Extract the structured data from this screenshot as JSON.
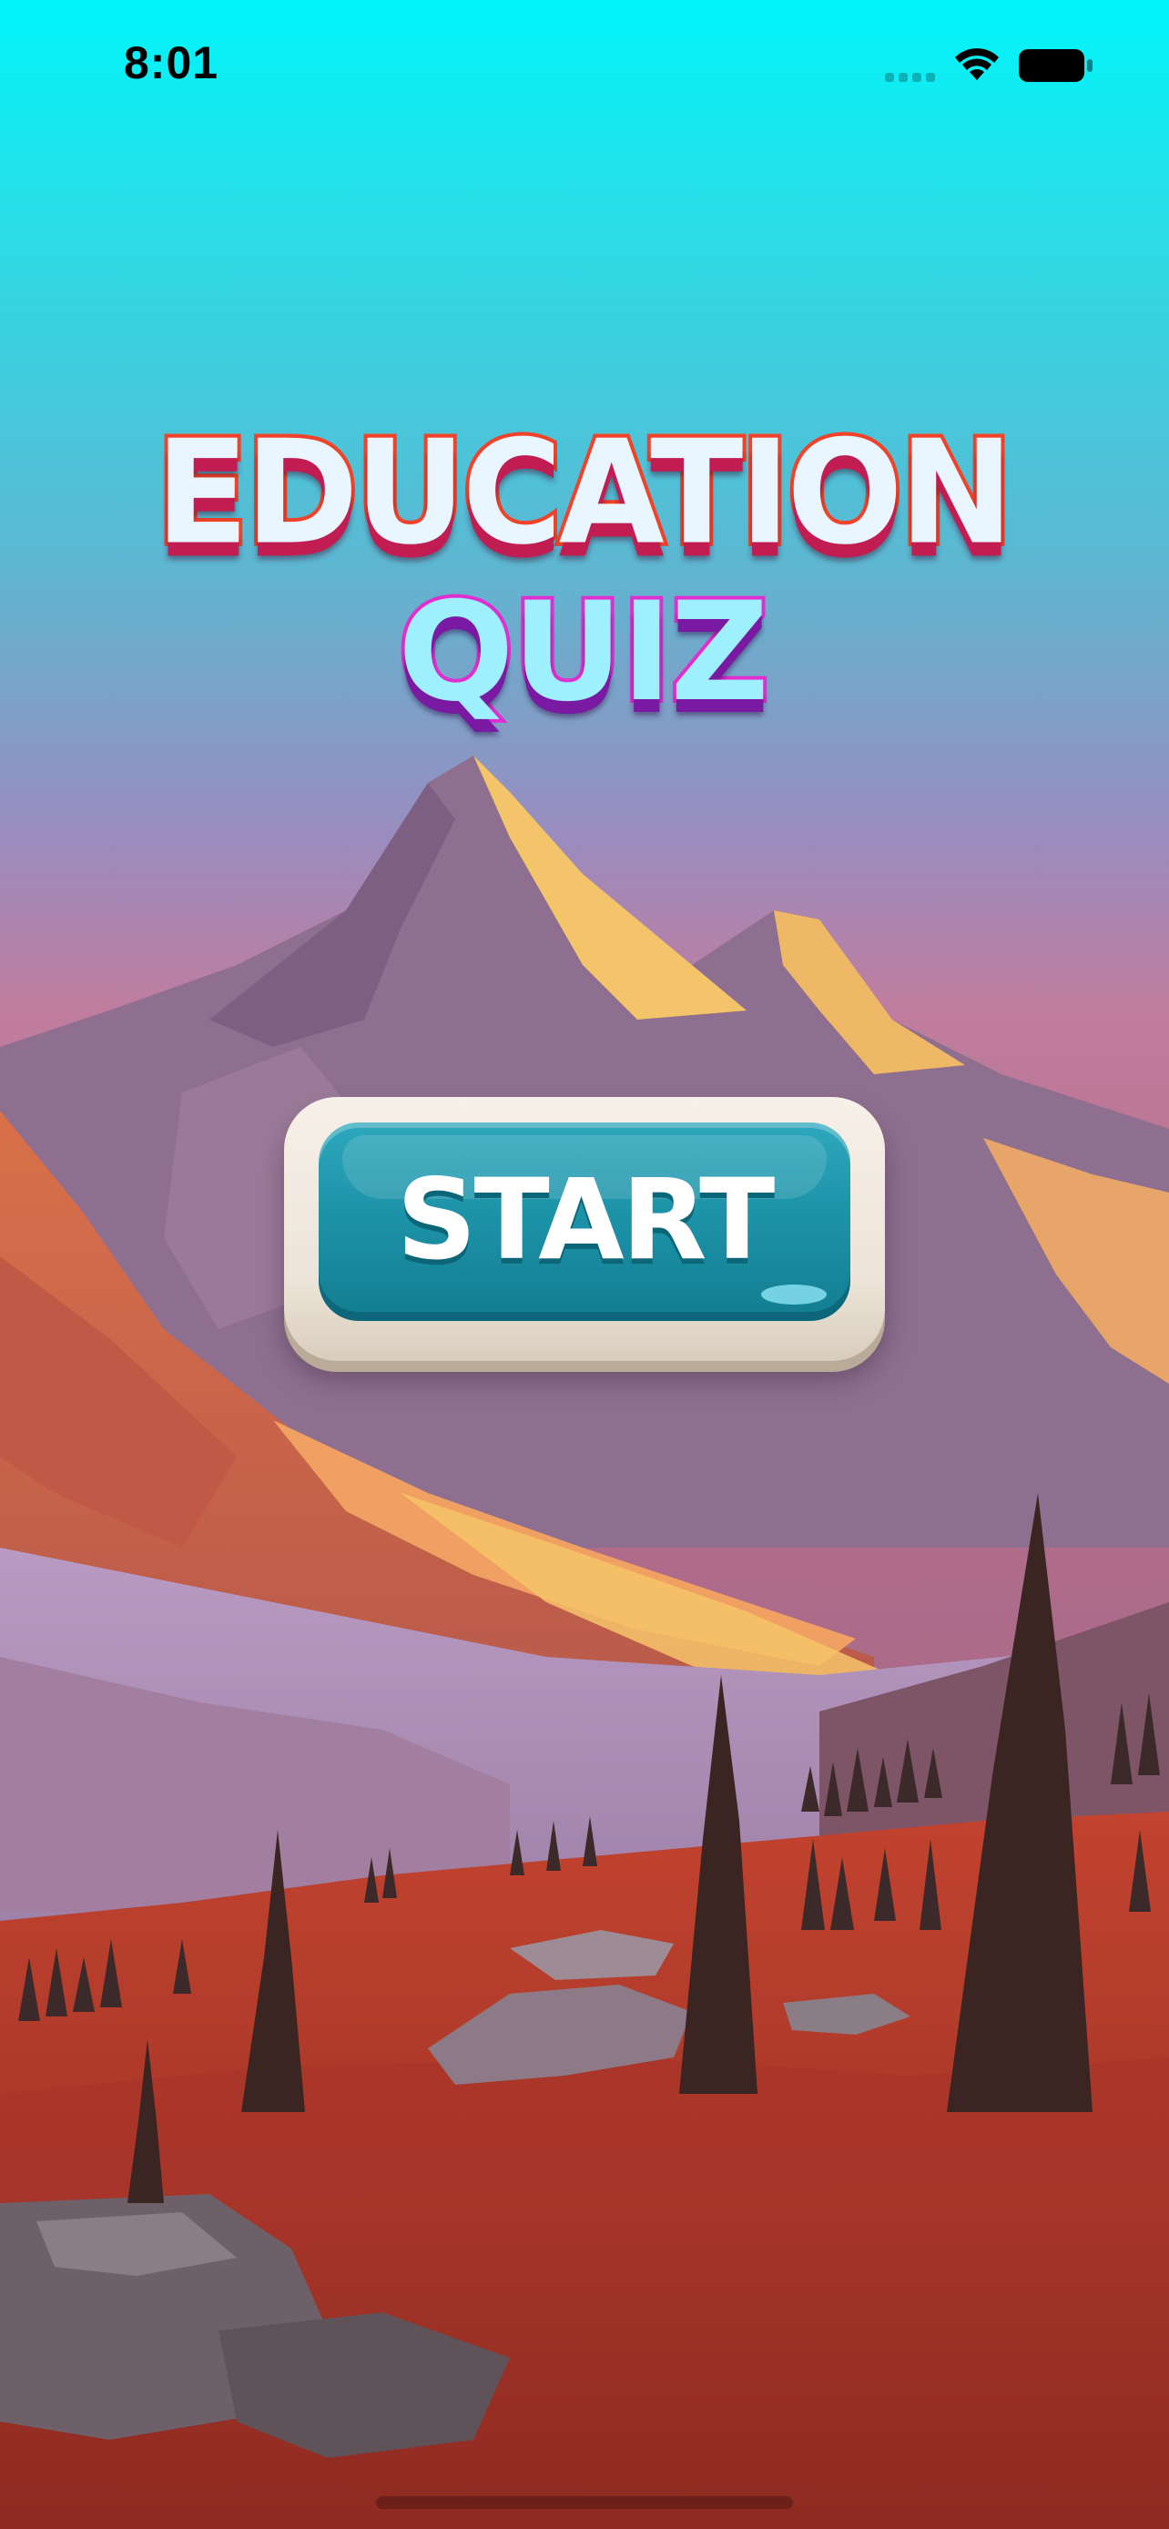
{
  "status_bar": {
    "time": "8:01",
    "signal_icon": "cellular-signal-icon",
    "wifi_icon": "wifi-icon",
    "battery_icon": "battery-icon"
  },
  "title": {
    "line_1": "EDUCATION",
    "line_2": "QUIZ",
    "line_1_fill": "#eaf6ff",
    "line_1_outline": "#f0432a",
    "line_2_fill": "#9ff0ff",
    "line_2_outline": "#e02fd0"
  },
  "start_button": {
    "label": "START",
    "fill": "#1d93a8",
    "frame": "#f4ede4"
  },
  "background": {
    "sky_top": "#00f5fb",
    "sky_mid": "#9a8cbf",
    "mountain": "#8e6f8f",
    "mountain_highlight": "#f3c46a",
    "slope": "#d9704a",
    "meadow": "#b83a2c",
    "trees": "#3a2522"
  }
}
